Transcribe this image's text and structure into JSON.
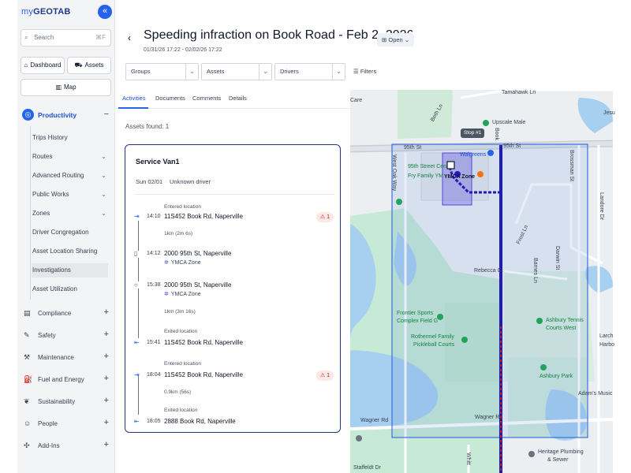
{
  "app": {
    "logo_my": "my",
    "logo_brand": "GEOTAB",
    "collapse_icon": "«"
  },
  "sidebar": {
    "search_placeholder": "Search",
    "search_shortcut": "⌘F",
    "dashboard_label": "Dashboard",
    "assets_label": "Assets",
    "map_label": "Map",
    "productivity_label": "Productivity",
    "sub_items": [
      {
        "label": "Trips History",
        "chev": ""
      },
      {
        "label": "Routes",
        "chev": "⌄"
      },
      {
        "label": "Advanced Routing",
        "chev": "⌄"
      },
      {
        "label": "Public Works",
        "chev": "⌄"
      },
      {
        "label": "Zones",
        "chev": "⌄"
      },
      {
        "label": "Driver Congregation",
        "chev": ""
      },
      {
        "label": "Asset Location Sharing",
        "chev": ""
      },
      {
        "label": "Investigations",
        "chev": ""
      },
      {
        "label": "Asset Utilization",
        "chev": ""
      }
    ],
    "groups": [
      {
        "label": "Compliance",
        "icon": "▤"
      },
      {
        "label": "Safety",
        "icon": "✎"
      },
      {
        "label": "Maintenance",
        "icon": "⚒"
      },
      {
        "label": "Fuel and Energy",
        "icon": "⛽"
      },
      {
        "label": "Sustainability",
        "icon": "❦"
      },
      {
        "label": "People",
        "icon": "☺"
      },
      {
        "label": "Add-Ins",
        "icon": "✣"
      }
    ]
  },
  "header": {
    "title": "Speeding infraction on Book Road - Feb 2, 2026",
    "status": "Open",
    "date_range": "01/31/26 17:22 - 02/02/26 17:22",
    "filters_label": "Filters",
    "dropdowns": [
      "Groups",
      "Assets",
      "Drivers"
    ]
  },
  "tabs": [
    "Activities",
    "Documents",
    "Comments",
    "Details"
  ],
  "assets_found": "Assets found: 1",
  "card": {
    "vehicle": "Service Van1",
    "date": "Sun 02/01",
    "driver": "Unknown driver",
    "events": [
      {
        "time": "14:10",
        "caption": "Entered location",
        "address": "11S452 Book Rd, Naperville",
        "zone": "",
        "alert": "1"
      },
      {
        "time": "14:12",
        "caption": "",
        "address": "2000 95th St, Naperville",
        "zone": "YMCA Zone",
        "alert": ""
      },
      {
        "time": "15:38",
        "caption": "",
        "address": "2000 95th St, Naperville",
        "zone": "YMCA Zone",
        "alert": ""
      },
      {
        "time": "15:41",
        "caption": "Exited location",
        "address": "11S452 Book Rd, Naperville",
        "zone": "",
        "alert": ""
      },
      {
        "time": "18:04",
        "caption": "Entered location",
        "address": "11S452 Book Rd, Naperville",
        "zone": "",
        "alert": "1"
      },
      {
        "time": "18:05",
        "caption": "Exited location",
        "address": "2888 Book Rd, Naperville",
        "zone": "",
        "alert": ""
      }
    ],
    "segments": [
      "1km (2m 6s)",
      "1km (3m 16s)",
      "0.9km (56s)"
    ]
  },
  "map": {
    "stop_label": "Stop #1",
    "labels": {
      "care": "Care",
      "tamahawk": "Tamahawk Ln",
      "jesu": "Jesu",
      "beth": "Beth Ln",
      "upscale": "Upscale Male",
      "st95_left": "95th St",
      "st95_right": "95th St",
      "cedar": "95th Street Cen",
      "fry": "Fry Family YM",
      "walgreens": "Walgreens",
      "ymca": "YMCA Zone",
      "brossman": "Brossman St",
      "oak": "West Oak Way",
      "landore": "Landore Dr",
      "frost": "Frost Ln",
      "darwin": "Darwin St",
      "barnes": "Barnes Ln",
      "rebecca": "Rebecca Ct",
      "frontier1": "Frontier Sports",
      "frontier2": "Complex Field G",
      "rothermel1": "Rothermel Family",
      "rothermel2": "Pickleball Courts",
      "ashbury_tennis1": "Ashbury Tennis",
      "ashbury_tennis2": "Courts West",
      "ashbury_park": "Ashbury Park",
      "adams": "Adam's Music",
      "wagner_left": "Wagner Rd",
      "wagner_mid": "Wagner Rd",
      "heritage1": "Heritage Plumbing",
      "heritage2": "& Sewer",
      "whitt": "Whitt",
      "staff": "Staffeldt Dr",
      "larch": "Larch",
      "harbo": "Harbo",
      "book": "Book"
    }
  },
  "colors": {
    "accent": "#2563eb",
    "card_border": "#2a3580",
    "route": "#1e1bb8",
    "geofence": "#3b6fd8"
  }
}
